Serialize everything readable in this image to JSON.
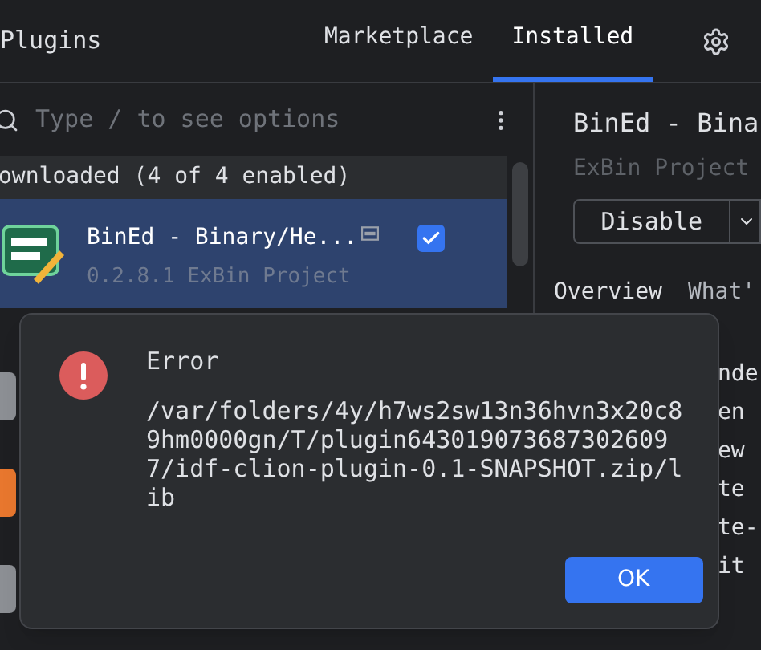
{
  "header": {
    "title": "Plugins",
    "tabs": [
      {
        "label": "Marketplace",
        "selected": false
      },
      {
        "label": "Installed",
        "selected": true
      }
    ]
  },
  "search": {
    "placeholder": "Type / to see options"
  },
  "group": {
    "label": "ownloaded (4 of 4 enabled)"
  },
  "plugins": [
    {
      "name": "BinEd - Binary/He...",
      "meta": "0.2.8.1 ExBin Project",
      "selected": true,
      "checked": true
    }
  ],
  "detail": {
    "title": "BinEd - Bina",
    "vendor": "ExBin Project",
    "button": "Disable",
    "tabs": [
      {
        "label": "Overview",
        "selected": true
      },
      {
        "label": "What'",
        "selected": false
      }
    ],
    "lines": [
      "nde",
      "en",
      "ew",
      "te",
      "te-",
      "it"
    ]
  },
  "dialog": {
    "title": "Error",
    "message": "/var/folders/4y/h7ws2sw13n36hvn3x20c89hm0000gn/T/plugin6430190736873026097/idf-clion-plugin-0.1-SNAPSHOT.zip/lib",
    "button": "OK"
  }
}
